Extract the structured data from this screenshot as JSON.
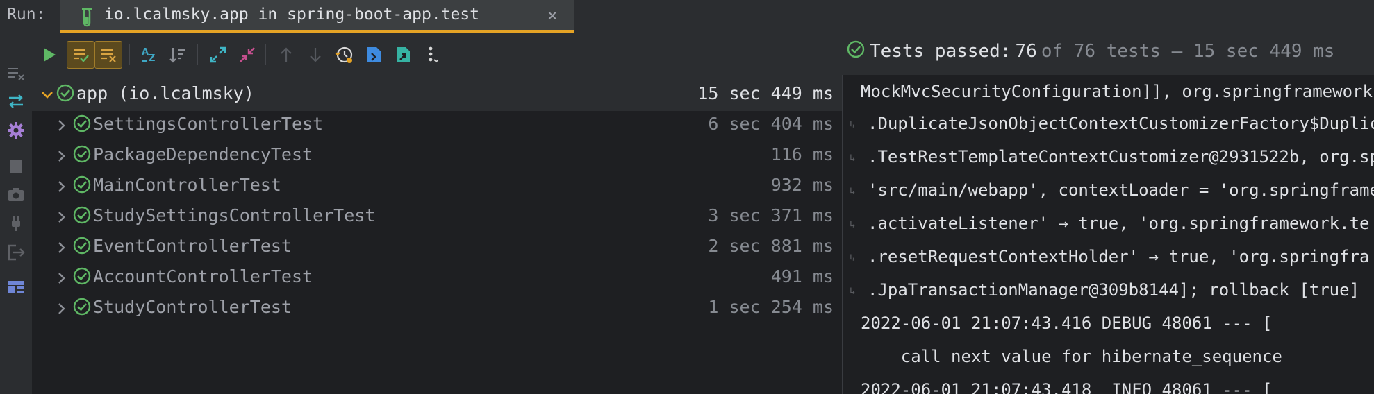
{
  "run": {
    "label": "Run:",
    "tab_title": "io.lcalmsky.app in spring-boot-app.test",
    "close_glyph": "×"
  },
  "status": {
    "prefix": "Tests passed:",
    "count": "76",
    "rest": "of 76 tests – 15 sec 449 ms"
  },
  "toolbar": {
    "icons": [
      "rerun-icon",
      "show-passed-icon",
      "show-ignored-icon",
      "sort-alpha-icon",
      "sort-duration-icon",
      "expand-all-icon",
      "collapse-all-icon",
      "prev-failed-icon",
      "next-failed-icon",
      "history-icon",
      "import-tests-icon",
      "export-tests-icon",
      "more-options-icon"
    ]
  },
  "tree": {
    "root": {
      "name": "app (io.lcalmsky)",
      "duration": "15 sec 449 ms"
    },
    "children": [
      {
        "name": "SettingsControllerTest",
        "duration": "6 sec 404 ms"
      },
      {
        "name": "PackageDependencyTest",
        "duration": "116 ms"
      },
      {
        "name": "MainControllerTest",
        "duration": "932 ms"
      },
      {
        "name": "StudySettingsControllerTest",
        "duration": "3 sec 371 ms"
      },
      {
        "name": "EventControllerTest",
        "duration": "2 sec 881 ms"
      },
      {
        "name": "AccountControllerTest",
        "duration": "491 ms"
      },
      {
        "name": "StudyControllerTest",
        "duration": "1 sec 254 ms"
      }
    ]
  },
  "console": {
    "lines": [
      "MockMvcSecurityConfiguration]], org.springframework",
      ".DuplicateJsonObjectContextCustomizerFactory$Duplic",
      ".TestRestTemplateContextCustomizer@2931522b, org.sp",
      "'src/main/webapp', contextLoader = 'org.springframe",
      ".activateListener' → true, 'org.springframework.te",
      ".resetRequestContextHolder' → true, 'org.springfra",
      ".JpaTransactionManager@309b8144]; rollback [true]",
      "2022-06-01 21:07:43.416 DEBUG 48061 --- [",
      "    call next value for hibernate_sequence",
      "2022-06-01 21:07:43.418  INFO 48061 --- ["
    ]
  },
  "colors": {
    "accent_orange": "#e5a325",
    "pass_green": "#5fb865",
    "background": "#1e1f22",
    "panel": "#2b2d30"
  }
}
